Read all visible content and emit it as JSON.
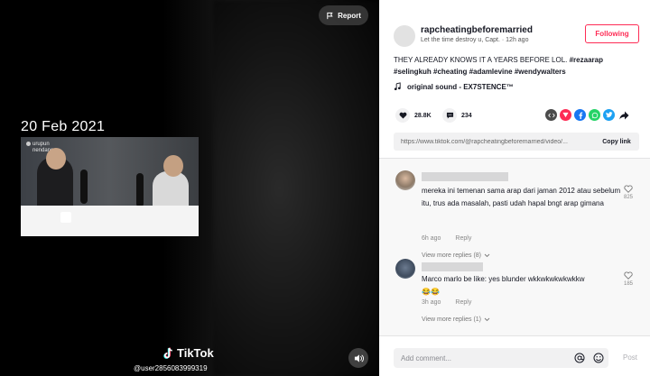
{
  "video": {
    "date_overlay": "20 Feb 2021",
    "clip_logo_line1": "urupun",
    "clip_logo_line2": "nendang",
    "report_label": "Report",
    "brand": "TikTok",
    "username": "@user2856083999319"
  },
  "post": {
    "author": "rapcheatingbeforemarried",
    "subtitle": "Let the time destroy u, Capt. · 12h ago",
    "follow_label": "Following",
    "caption_text": "THEY ALREADY KNOWS IT A YEARS BEFORE LOL.",
    "caption_tag1": "#rezaarap",
    "caption_tags": "#selingkuh #cheating #adamlevine #wendywalters",
    "sound": "original sound - EX7STENCE™",
    "likes": "28.8K",
    "comments_count": "234",
    "link": "https://www.tiktok.com/@rapcheatingbeforemarried/video/...",
    "copy_label": "Copy link"
  },
  "share_colors": {
    "embed": "#4b4b4b",
    "friends": "#fe2c55",
    "facebook": "#1877f2",
    "whatsapp": "#25d366",
    "twitter": "#1da1f2"
  },
  "comments": [
    {
      "text": "mereka ini temenan sama arap dari jaman 2012 atau sebelum itu, trus ada masalah, pasti udah hapal bngt arap gimana",
      "time": "6h ago",
      "reply": "Reply",
      "likes": "825",
      "more": "View more replies (8)"
    },
    {
      "text": "Marco marlo be like: yes blunder wkkwkwkwkwkkw",
      "emoji": "😂😂",
      "time": "3h ago",
      "reply": "Reply",
      "likes": "185",
      "more": "View more replies (1)"
    }
  ],
  "composer": {
    "placeholder": "Add comment...",
    "post_label": "Post"
  }
}
